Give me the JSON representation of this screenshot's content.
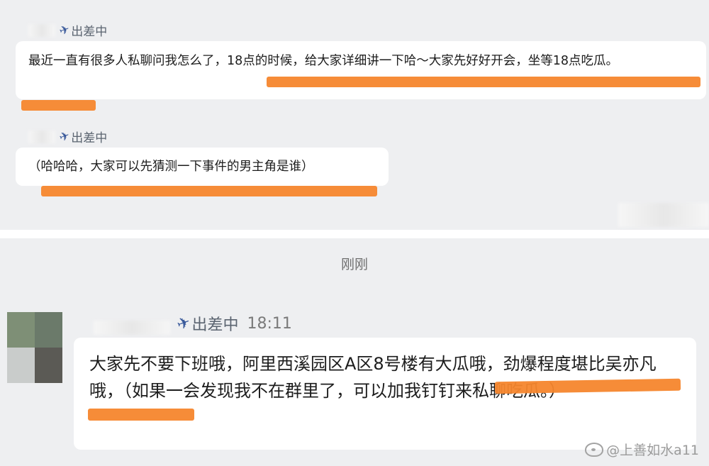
{
  "top_panel": {
    "messages": [
      {
        "sender_label": "出差中",
        "text": "最近一直有很多人私聊问我怎么了，18点的时候，给大家详细讲一下哈～大家先好好开会，坐等18点吃瓜。"
      },
      {
        "sender_label": "出差中",
        "text": "（哈哈哈，大家可以先猜测一下事件的男主角是谁）"
      }
    ]
  },
  "bottom_panel": {
    "time_separator": "刚刚",
    "message": {
      "sender_label": "出差中",
      "time": "18:11",
      "text": "大家先不要下班哦，阿里西溪园区A区8号楼有大瓜哦，劲爆程度堪比吴亦凡哦，（如果一会发现我不在群里了，可以加我钉钉来私聊吃瓜。）"
    }
  },
  "watermark": "@上善如水a11",
  "colors": {
    "highlight": "#f6862d",
    "panel_bg": "#eeeff1",
    "bubble_bg": "#ffffff",
    "airplane_icon": "#3a5a9b"
  }
}
